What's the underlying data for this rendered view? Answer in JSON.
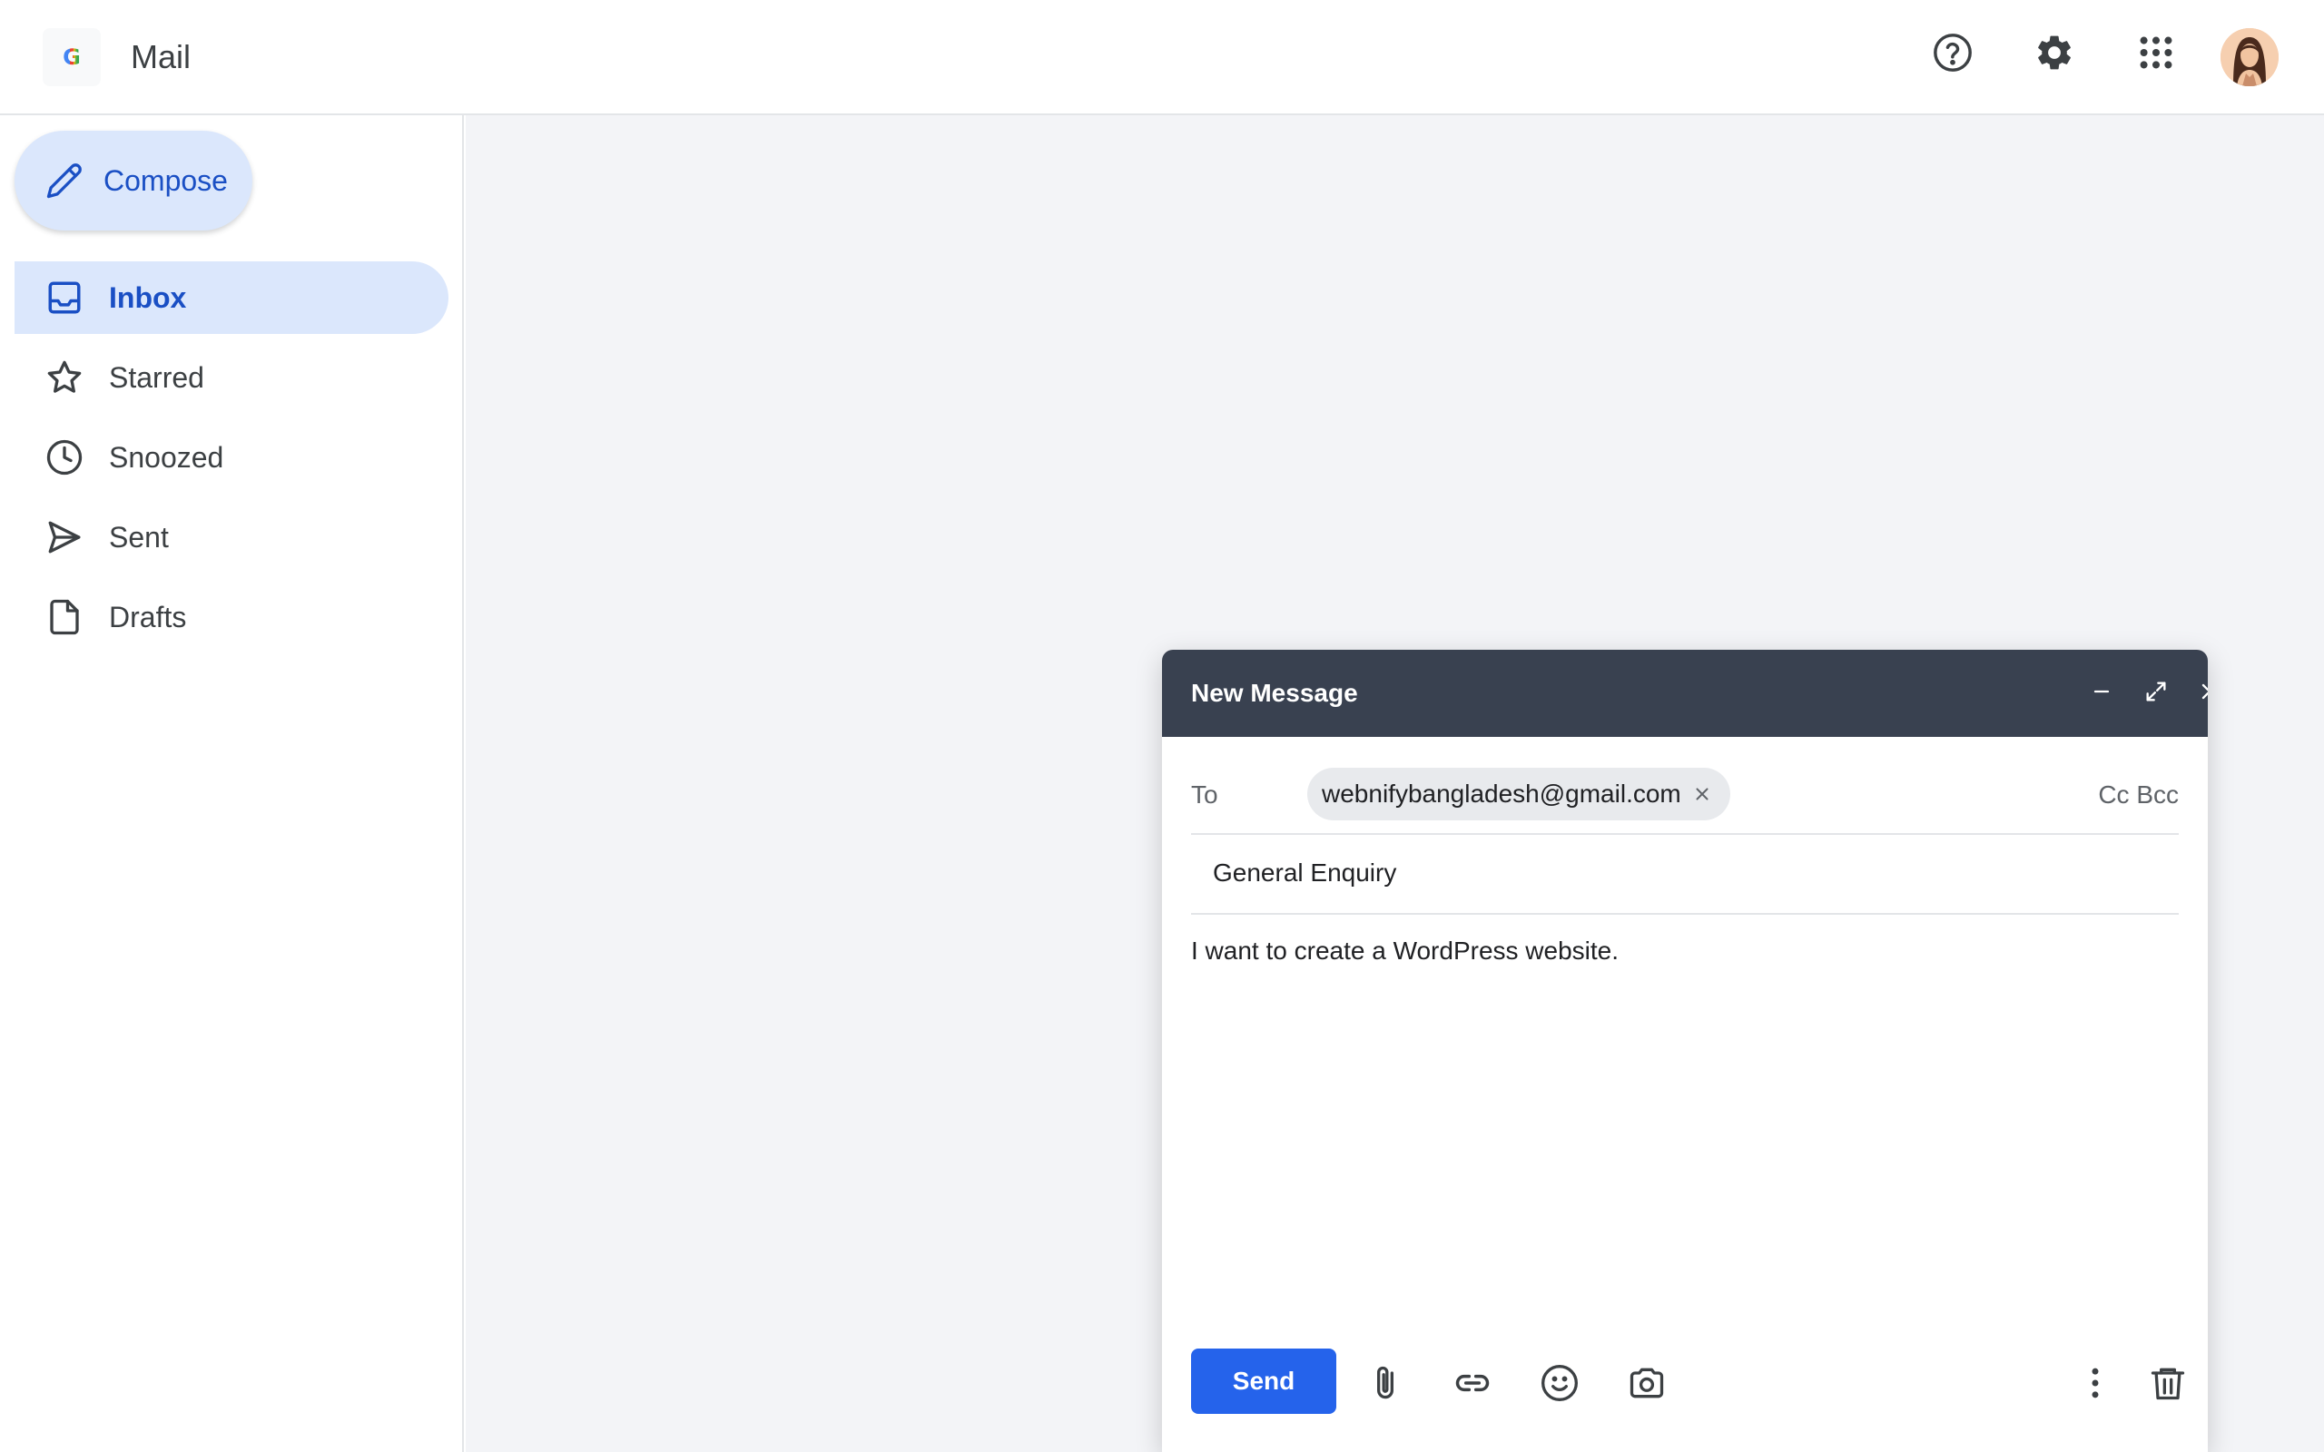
{
  "header": {
    "logo_letter": "G",
    "app_title": "Mail"
  },
  "icons": {
    "help": "help-circle-icon",
    "settings": "gear-icon",
    "apps": "grid-apps-icon",
    "avatar": "user-avatar"
  },
  "sidebar": {
    "compose_label": "Compose",
    "items": [
      {
        "label": "Inbox",
        "icon": "inbox-icon",
        "active": true
      },
      {
        "label": "Starred",
        "icon": "star-icon",
        "active": false
      },
      {
        "label": "Snoozed",
        "icon": "clock-icon",
        "active": false
      },
      {
        "label": "Sent",
        "icon": "send-icon",
        "active": false
      },
      {
        "label": "Drafts",
        "icon": "file-icon",
        "active": false
      }
    ]
  },
  "compose_window": {
    "title": "New Message",
    "to_label": "To",
    "recipient": "webnifybangladesh@gmail.com",
    "cc_bcc": "Cc Bcc",
    "subject": "General Enquiry",
    "body": "I want to create a WordPress website.",
    "send_label": "Send"
  },
  "colors": {
    "accent": "#1a4fc4",
    "send_button": "#2563eb",
    "compose_header": "#394150",
    "active_nav": "#dbe7fc"
  }
}
